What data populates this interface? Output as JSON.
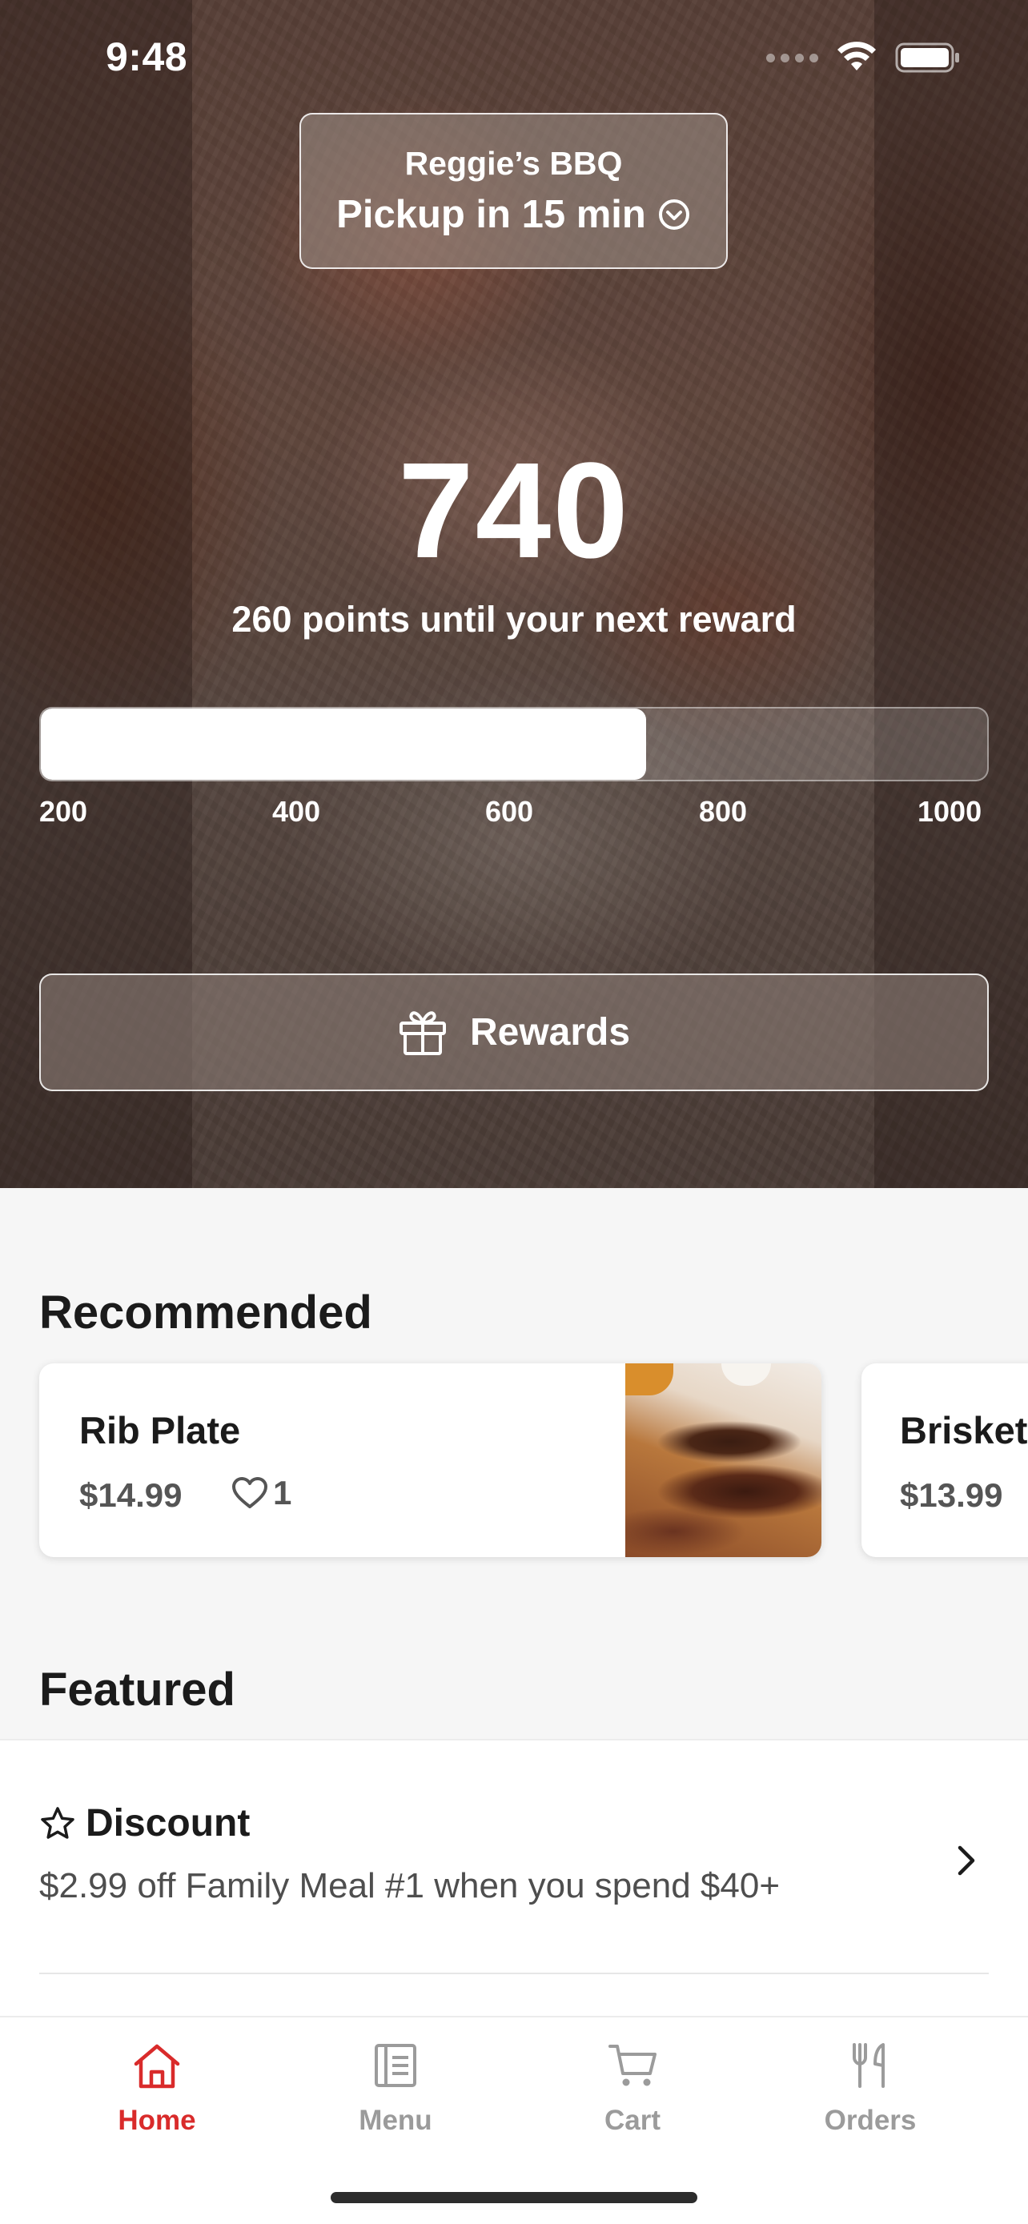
{
  "status_bar": {
    "time": "9:48"
  },
  "header": {
    "restaurant_name": "Reggie’s BBQ",
    "pickup_text": "Pickup in 15 min"
  },
  "points": {
    "value": "740",
    "caption": "260 points until your next reward",
    "progress_fraction": 0.64,
    "ticks": [
      "200",
      "400",
      "600",
      "800",
      "1000"
    ]
  },
  "rewards_button": {
    "label": "Rewards"
  },
  "recommended": {
    "title": "Recommended",
    "items": [
      {
        "name": "Rib Plate",
        "price": "$14.99",
        "likes": "1"
      },
      {
        "name": "Brisket",
        "price": "$13.99"
      }
    ]
  },
  "featured": {
    "title": "Featured",
    "discount": {
      "title": "Discount",
      "description": "$2.99 off Family Meal #1 when you spend $40+"
    }
  },
  "tabs": [
    {
      "label": "Home",
      "active": true
    },
    {
      "label": "Menu",
      "active": false
    },
    {
      "label": "Cart",
      "active": false
    },
    {
      "label": "Orders",
      "active": false
    }
  ],
  "colors": {
    "accent": "#d92b2b",
    "inactive_tab": "#9b9b9b",
    "background": "#f6f6f6"
  },
  "icons": {
    "pickup_chevron": "chevron-down-circle-icon",
    "rewards": "gift-icon",
    "like": "heart-icon",
    "discount": "star-icon",
    "discount_action": "chevron-right-icon",
    "tabs": [
      "home-icon",
      "menu-icon",
      "cart-icon",
      "orders-icon"
    ]
  }
}
